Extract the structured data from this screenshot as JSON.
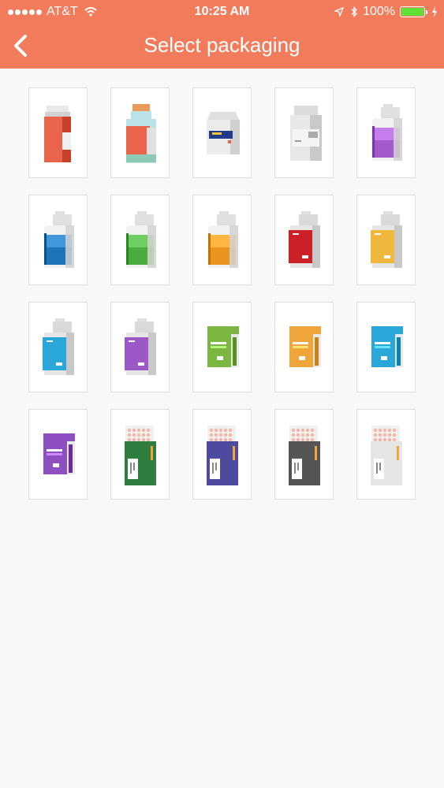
{
  "status_bar": {
    "carrier": "AT&T",
    "time": "10:25 AM",
    "battery": "100%",
    "colors": {
      "bar": "#f27b5b",
      "battery": "#5fe13a"
    },
    "icons": [
      "signal-dots-icon",
      "wifi-icon",
      "location-icon",
      "bluetooth-icon",
      "battery-icon",
      "charging-icon"
    ]
  },
  "nav": {
    "title": "Select packaging",
    "back_icon": "chevron-left-icon"
  },
  "packages": [
    {
      "kind": "rx-bottle",
      "color": "#e9644a"
    },
    {
      "kind": "glass-vial",
      "color": "#e9644a"
    },
    {
      "kind": "carton-box",
      "color": "#233a8b"
    },
    {
      "kind": "label-bottle",
      "color": "#c9c9c9"
    },
    {
      "kind": "liquid-bottle",
      "color": "#a259c9"
    },
    {
      "kind": "liquid-bottle",
      "color": "#1f73b7"
    },
    {
      "kind": "liquid-bottle",
      "color": "#4aab3e"
    },
    {
      "kind": "liquid-bottle",
      "color": "#e8941e"
    },
    {
      "kind": "label-box-bottle",
      "color": "#cc1f26"
    },
    {
      "kind": "label-box-bottle",
      "color": "#f0b73d"
    },
    {
      "kind": "label-box-bottle",
      "color": "#2aa7d9"
    },
    {
      "kind": "label-box-bottle",
      "color": "#9b58c6"
    },
    {
      "kind": "jar",
      "color": "#7ab640"
    },
    {
      "kind": "jar",
      "color": "#f0a53a"
    },
    {
      "kind": "jar",
      "color": "#2aa7d9"
    },
    {
      "kind": "jar",
      "color": "#8e4fc2"
    },
    {
      "kind": "blister-box",
      "color": "#2f7e3f"
    },
    {
      "kind": "blister-box",
      "color": "#4d4aa0"
    },
    {
      "kind": "blister-box",
      "color": "#555555"
    },
    {
      "kind": "blister-box",
      "color": "#e6e6e6"
    }
  ]
}
